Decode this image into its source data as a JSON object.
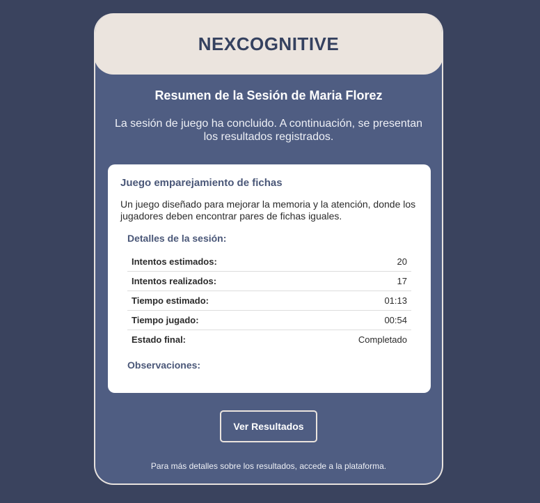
{
  "header": {
    "brand": "NEXCOGNITIVE"
  },
  "summary": {
    "title": "Resumen de la Sesión de Maria Florez",
    "intro": "La sesión de juego ha concluido. A continuación, se presentan los resultados registrados."
  },
  "game": {
    "title": "Juego emparejamiento de fichas",
    "description": "Un juego diseñado para mejorar la memoria y la atención, donde los jugadores deben encontrar pares de fichas iguales."
  },
  "details": {
    "section_title": "Detalles de la sesión:",
    "rows": [
      {
        "label": "Intentos estimados:",
        "value": "20"
      },
      {
        "label": "Intentos realizados:",
        "value": "17"
      },
      {
        "label": "Tiempo estimado:",
        "value": "01:13"
      },
      {
        "label": "Tiempo jugado:",
        "value": "00:54"
      },
      {
        "label": "Estado final:",
        "value": "Completado"
      }
    ]
  },
  "observations": {
    "title": "Observaciones:"
  },
  "actions": {
    "results_button": "Ver Resultados"
  },
  "footer": {
    "text": "Para más detalles sobre los resultados, accede a la plataforma."
  },
  "colors": {
    "page_background": "#3a435e",
    "card_background": "#4f5d82",
    "header_background": "#ebe4de",
    "accent_text": "#4a5778"
  }
}
